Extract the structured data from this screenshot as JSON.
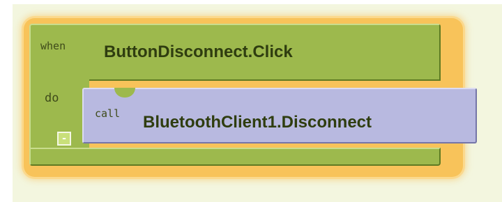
{
  "event_block": {
    "keyword": "when",
    "component_event": "ButtonDisconnect.Click",
    "do_label": "do",
    "collapse_symbol": "-"
  },
  "call_block": {
    "keyword": "call",
    "method": "BluetoothClient1.Disconnect"
  },
  "colors": {
    "workspace": "#f3f6df",
    "event_block": "#9db94d",
    "call_block": "#b8b9e0",
    "selection_glow": "#f8c35a"
  }
}
